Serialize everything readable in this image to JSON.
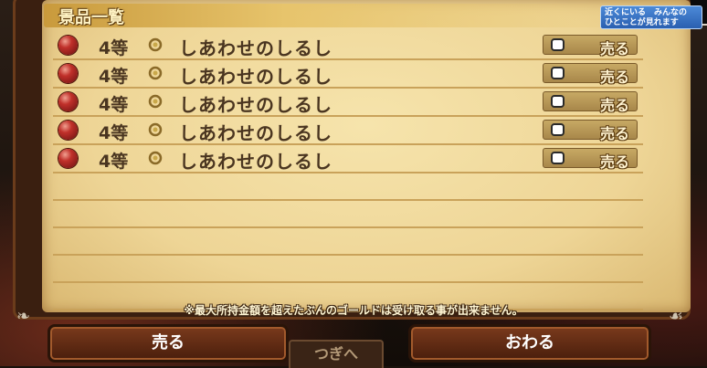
{
  "panel": {
    "title": "景品一覧"
  },
  "prizes": [
    {
      "rank": "4等",
      "name": "しあわせのしるし",
      "checked": false,
      "sell_label": "売る"
    },
    {
      "rank": "4等",
      "name": "しあわせのしるし",
      "checked": false,
      "sell_label": "売る"
    },
    {
      "rank": "4等",
      "name": "しあわせのしるし",
      "checked": false,
      "sell_label": "売る"
    },
    {
      "rank": "4等",
      "name": "しあわせのしるし",
      "checked": false,
      "sell_label": "売る"
    },
    {
      "rank": "4等",
      "name": "しあわせのしるし",
      "checked": false,
      "sell_label": "売る"
    }
  ],
  "note": "※最大所持金額を超えたぶんのゴールドは受け取る事が出来ません。",
  "notification": {
    "line1": "近くにいる　みんなの",
    "line2": "ひとことが見れます"
  },
  "buttons": {
    "sell": "売る",
    "close": "おわる",
    "next": "つぎへ"
  },
  "icons": {
    "prize_ball": "red-orb-icon",
    "ring": "ring-icon",
    "checkbox": "checkbox-icon"
  },
  "colors": {
    "parchment": "#eed596",
    "frame": "#3a1f10",
    "title_band": "#c99a3c",
    "button": "#5a2812"
  }
}
